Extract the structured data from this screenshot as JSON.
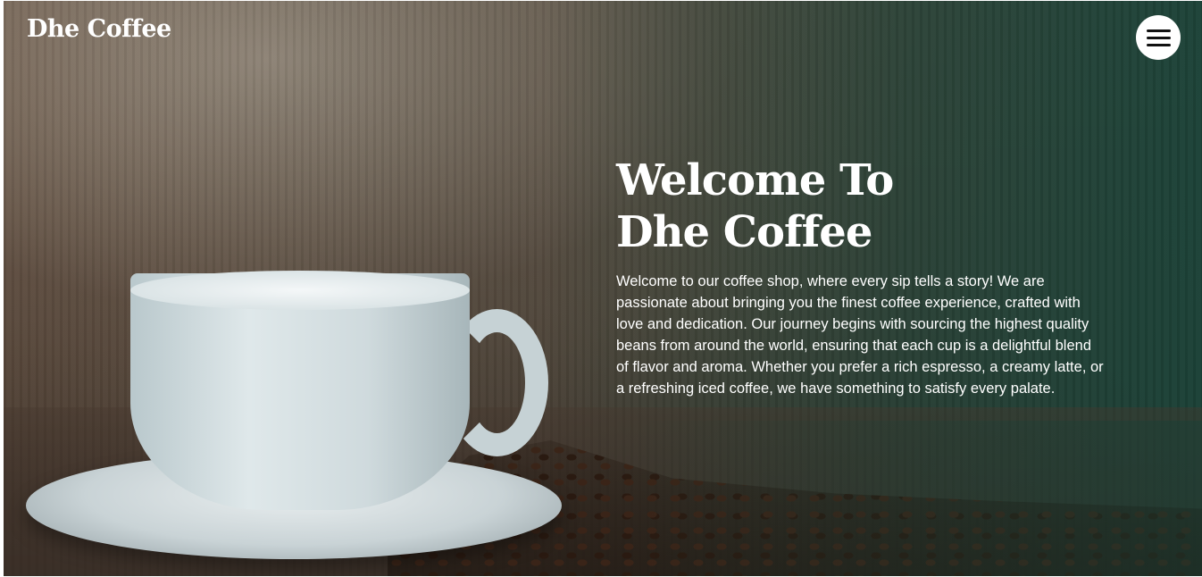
{
  "header": {
    "brand": "Dhe Coffee",
    "menu_icon": "hamburger-menu-icon"
  },
  "hero": {
    "title_line1": "Welcome To",
    "title_line2": "Dhe Coffee",
    "description": "Welcome to our coffee shop, where every sip tells a story! We are passionate about bringing you the finest coffee experience, crafted with love and dedication. Our journey begins with sourcing the highest quality beans from around the world, ensuring that each cup is a delightful blend of flavor and aroma. Whether you prefer a rich espresso, a creamy latte, or a refreshing iced coffee, we have something to satisfy every palate."
  },
  "colors": {
    "accent_dark_green": "#164036",
    "text": "#ffffff",
    "menu_button_bg": "#ffffff"
  }
}
